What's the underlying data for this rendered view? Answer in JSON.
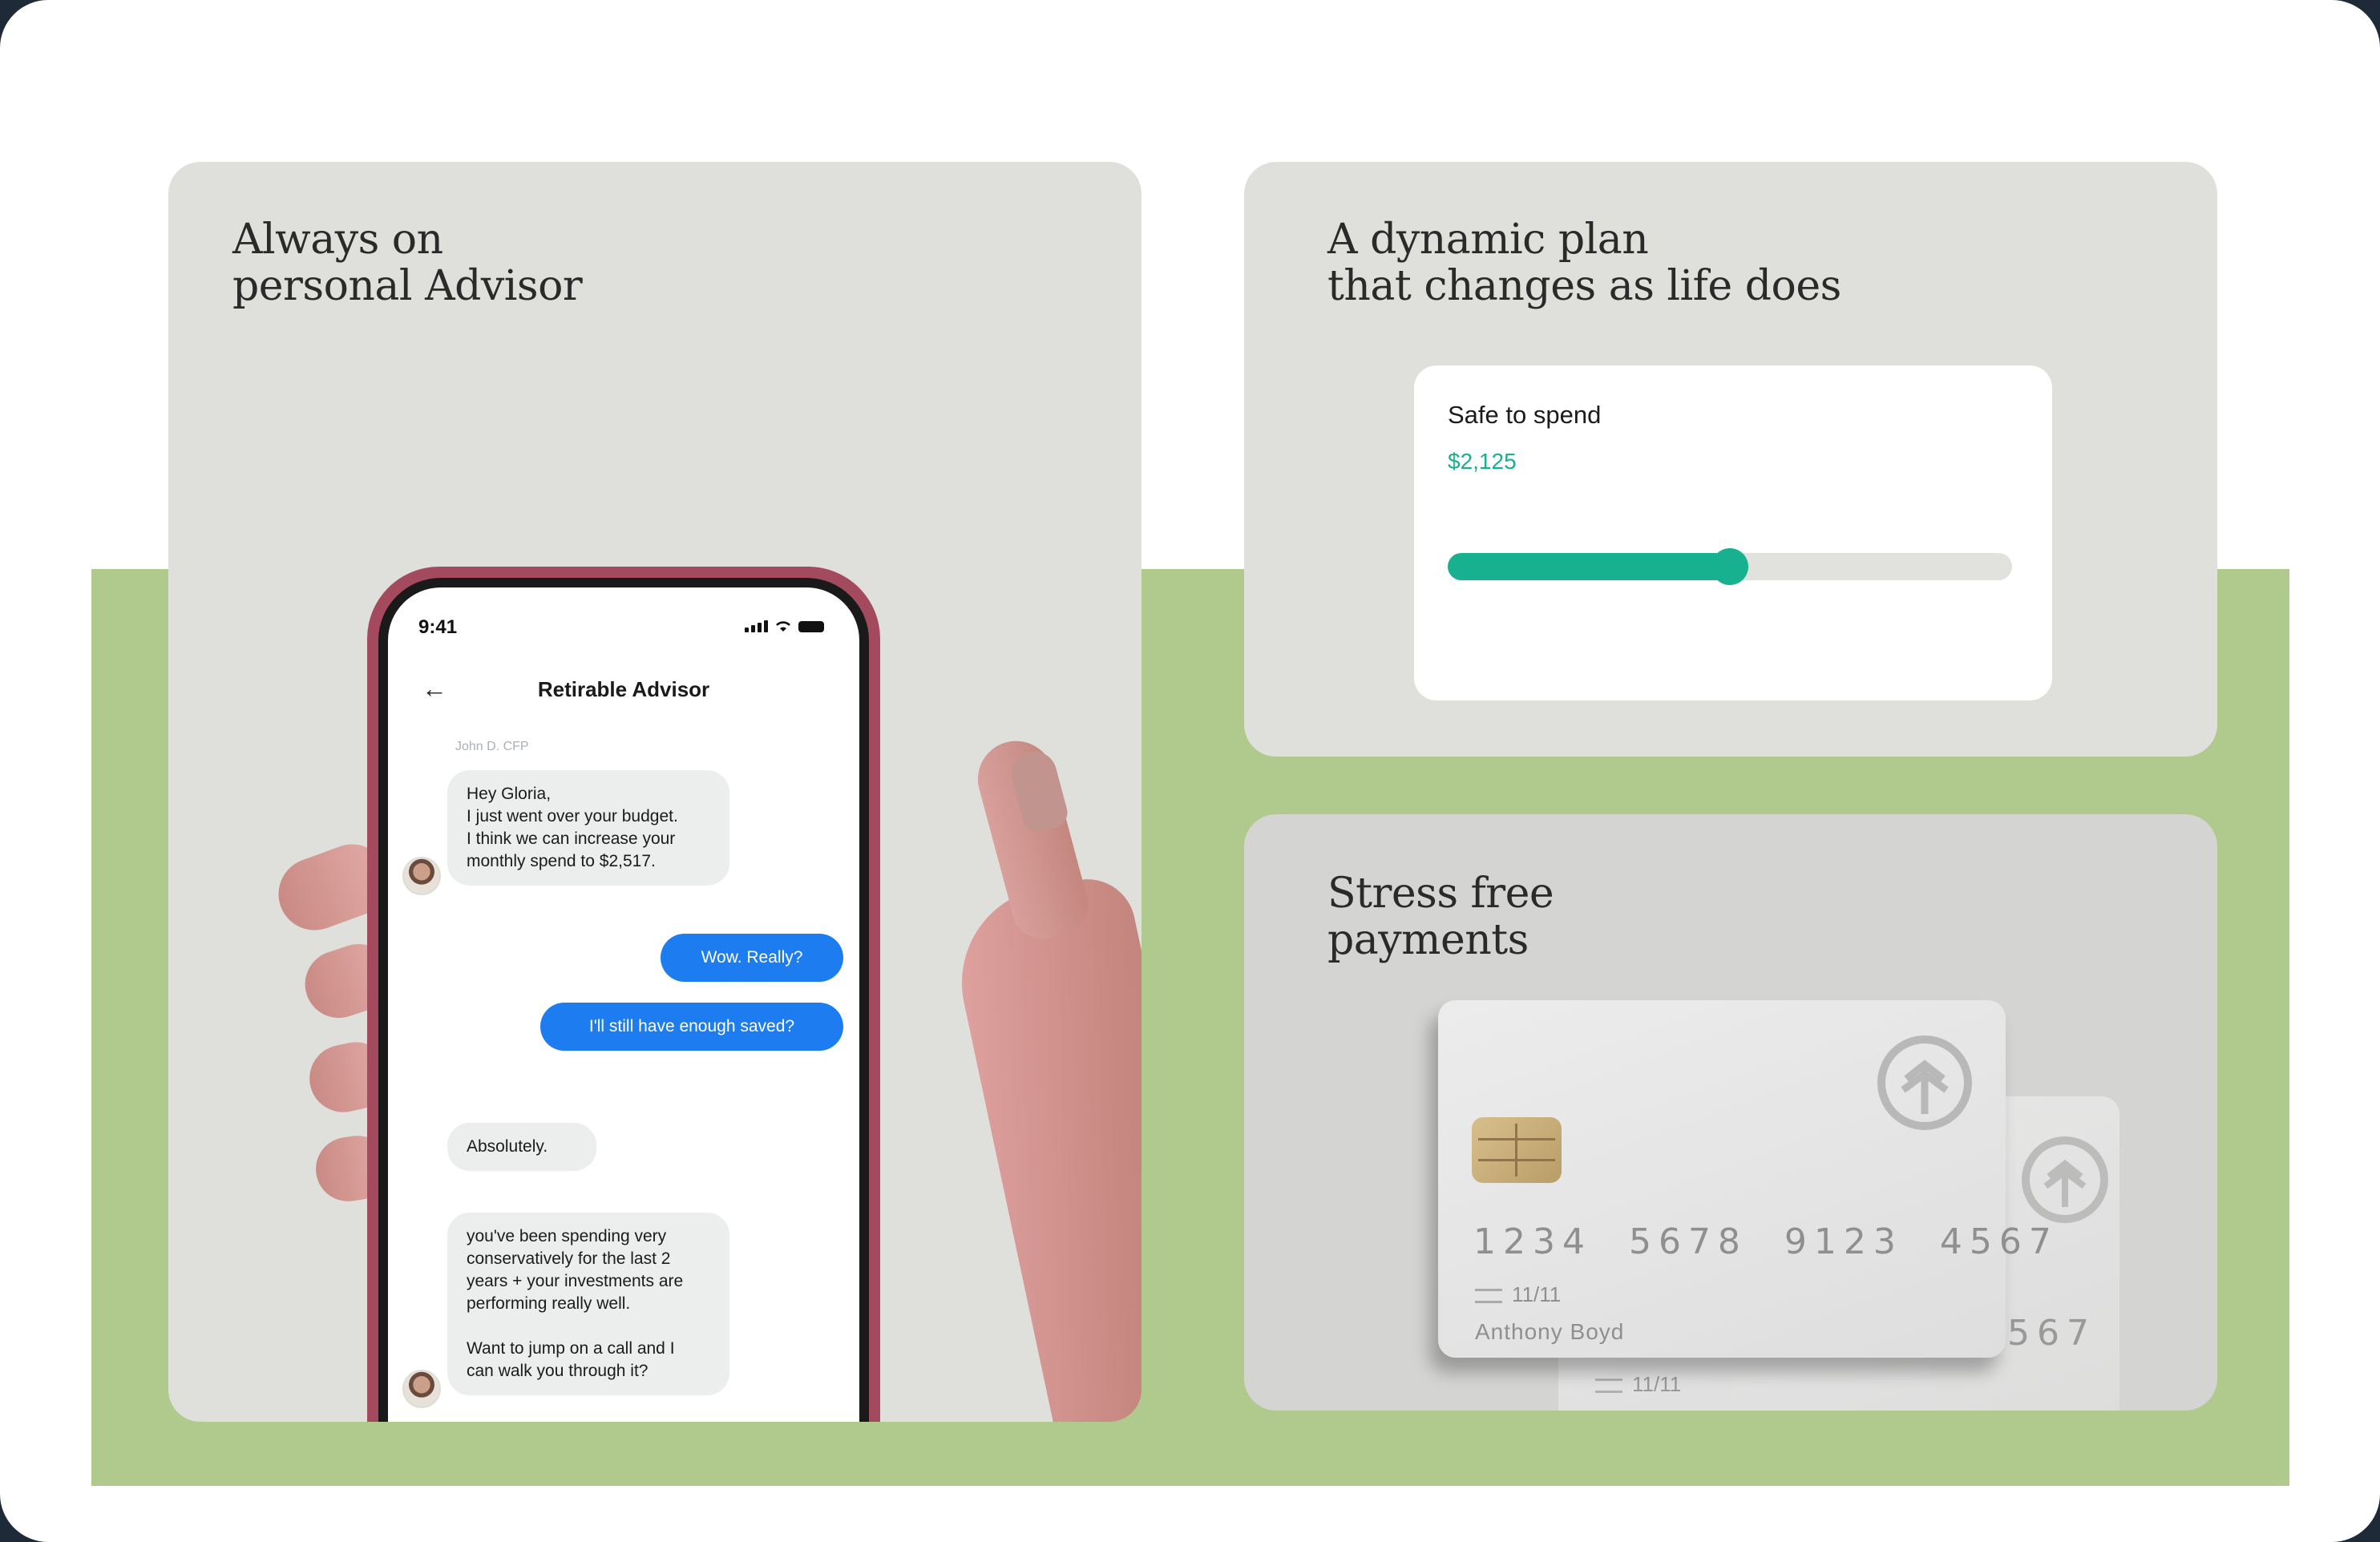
{
  "advisor_card": {
    "title": "Always on\npersonal Advisor",
    "phone": {
      "status_time": "9:41",
      "chat_title": "Retirable Advisor",
      "sender_name": "John D. CFP",
      "messages": [
        {
          "direction": "in",
          "text": "Hey Gloria,\nI just went over your budget.\nI think we can increase your\nmonthly spend to $2,517."
        },
        {
          "direction": "out",
          "text": "Wow. Really?"
        },
        {
          "direction": "out",
          "text": "I'll still have enough saved?"
        },
        {
          "direction": "in",
          "text": "Absolutely."
        },
        {
          "direction": "in",
          "text": "you've been spending very\nconservatively for the last 2\nyears + your investments are\nperforming really well.\n\nWant to jump on a call and I\ncan walk you through it?"
        }
      ]
    }
  },
  "plan_card": {
    "title": "A dynamic plan\nthat changes as life does",
    "widget": {
      "label": "Safe to spend",
      "value": "$2,125",
      "progress_fraction": 0.5
    }
  },
  "payments_card": {
    "title": "Stress free\npayments",
    "front_card": {
      "number": "1234  5678  9123  4567",
      "expiry": "11/11",
      "holder": "Anthony Boyd"
    },
    "back_card": {
      "number_partial": "567",
      "expiry": "11/11"
    }
  },
  "colors": {
    "green_band": "#b0c98d",
    "card_bg": "#dfdfdb",
    "accent_teal": "#18b18f",
    "chat_blue": "#1c7cf0",
    "phone_frame": "#a44a5e"
  }
}
